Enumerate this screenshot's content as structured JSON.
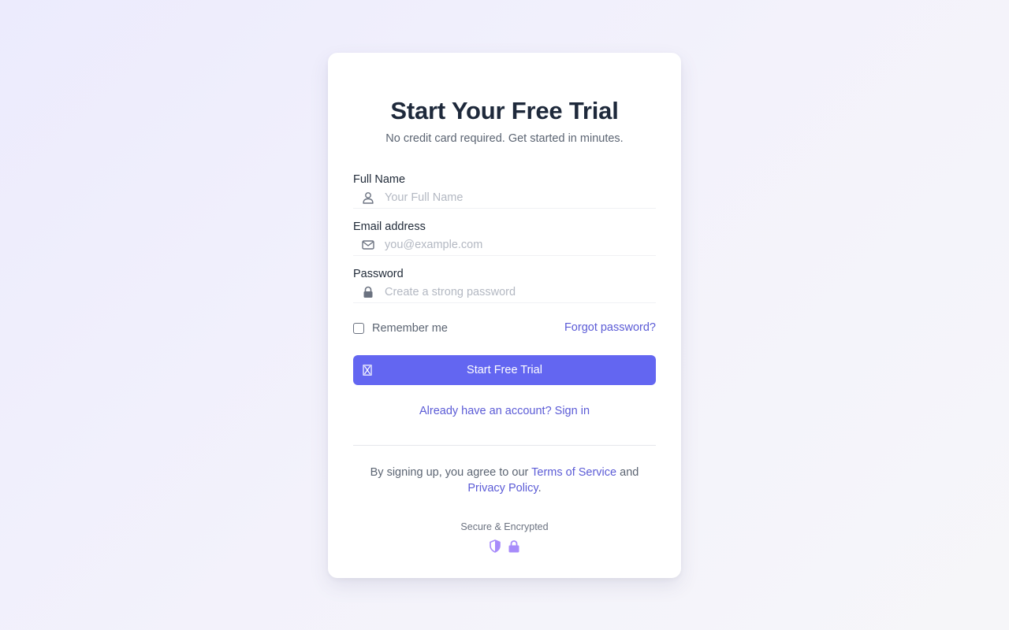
{
  "header": {
    "title": "Start Your Free Trial",
    "subtitle": "No credit card required. Get started in minutes."
  },
  "form": {
    "full_name": {
      "label": "Full Name",
      "placeholder": "Your Full Name",
      "value": "",
      "icon": "user-icon"
    },
    "email": {
      "label": "Email address",
      "placeholder": "you@example.com",
      "value": "",
      "icon": "envelope-icon"
    },
    "password": {
      "label": "Password",
      "placeholder": "Create a strong password",
      "value": "",
      "icon": "lock-icon"
    },
    "remember_label": "Remember me",
    "remember_checked": false,
    "forgot_label": "Forgot password?",
    "submit_label": "Start Free Trial",
    "submit_icon": "hourglass-icon"
  },
  "signin": {
    "label": "Already have an account? Sign in"
  },
  "legal": {
    "prefix": "By signing up, you agree to our ",
    "terms_label": "Terms of Service",
    "middle": " and",
    "privacy_label": "Privacy Policy",
    "suffix": "."
  },
  "security": {
    "label": "Secure & Encrypted",
    "icons": [
      "shield-icon",
      "lock-icon"
    ]
  },
  "colors": {
    "accent": "#6366f1",
    "link": "#5b5bd6",
    "security_icon": "#a78bfa",
    "title": "#1e293b",
    "muted": "#5b6472"
  }
}
